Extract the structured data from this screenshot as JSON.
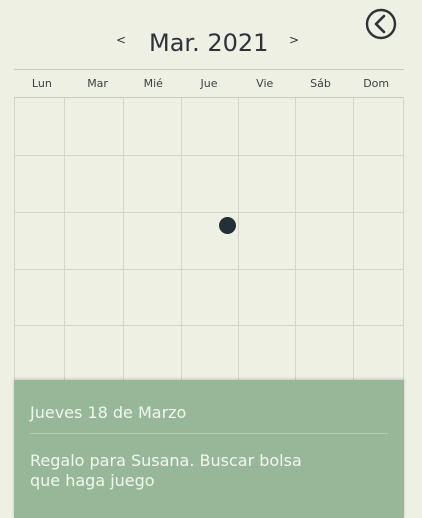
{
  "header": {
    "prev_label": "<",
    "month_title": "Mar. 2021",
    "next_label": ">",
    "back_icon": "chevron-left-circle-icon"
  },
  "weekdays": [
    "Lun",
    "Mar",
    "Mié",
    "Jue",
    "Vie",
    "Sáb",
    "Dom"
  ],
  "calendar": {
    "marked_day": "Jueves 18 de Marzo",
    "marker_color": "#243038"
  },
  "event": {
    "date_label": "Jueves 18 de Marzo",
    "note": "Regalo para Susana. Buscar bolsa que haga juego",
    "panel_color": "#97b898"
  }
}
